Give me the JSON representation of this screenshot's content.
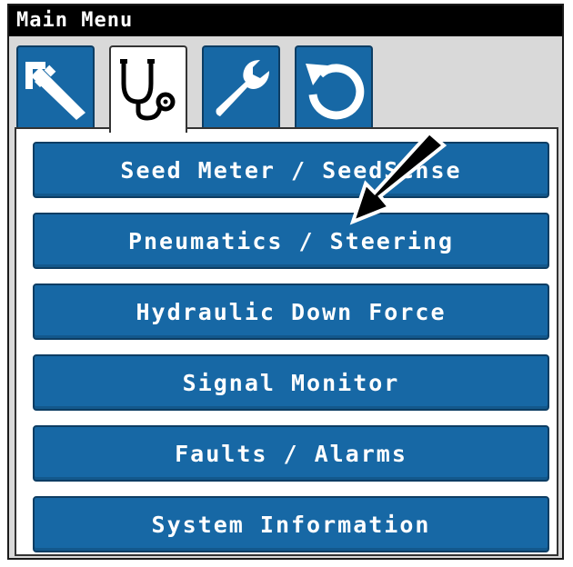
{
  "window": {
    "title": "Main Menu"
  },
  "tabs": [
    {
      "icon": "caliper-icon",
      "active": false
    },
    {
      "icon": "stethoscope-icon",
      "active": true
    },
    {
      "icon": "wrench-icon",
      "active": false
    },
    {
      "icon": "refresh-icon",
      "active": false
    }
  ],
  "menu": {
    "items": [
      {
        "label": "Seed Meter / SeedSense"
      },
      {
        "label": "Pneumatics / Steering"
      },
      {
        "label": "Hydraulic Down Force"
      },
      {
        "label": "Signal Monitor"
      },
      {
        "label": "Faults / Alarms"
      },
      {
        "label": "System Information"
      }
    ]
  },
  "colors": {
    "accent": "#1768a5",
    "accent_border": "#0d3d63",
    "titlebar": "#000000",
    "tab_strip": "#d9d9d9"
  }
}
